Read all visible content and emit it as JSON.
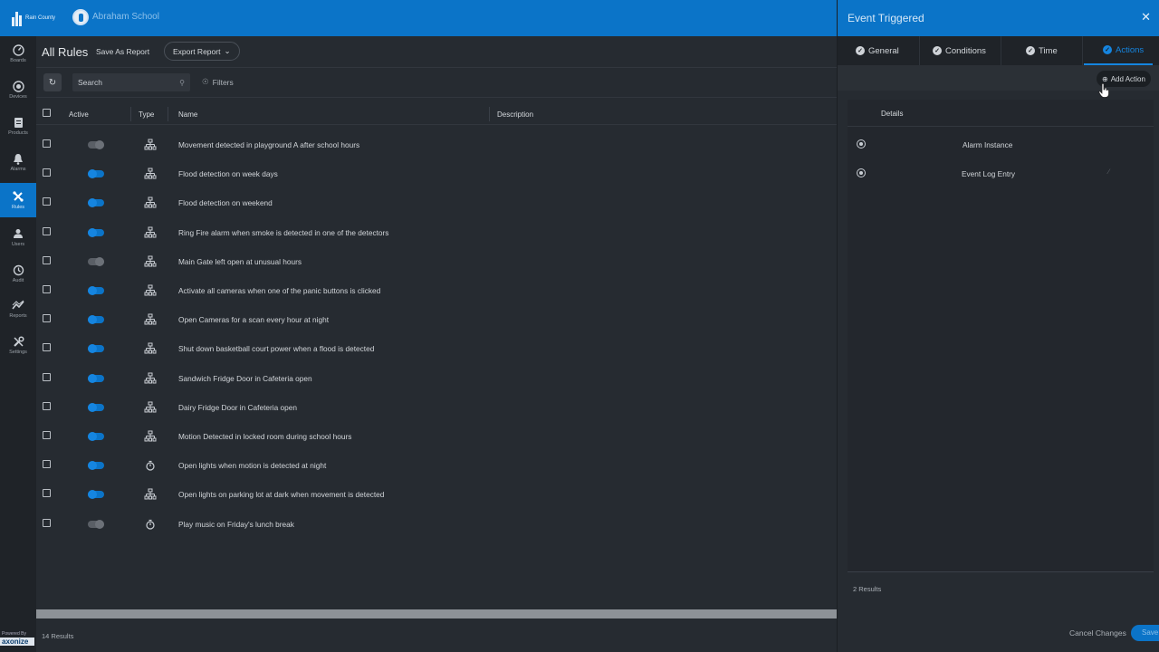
{
  "header": {
    "county_logo_text": "Rain County",
    "school_name": "Abraham School"
  },
  "sidebar": {
    "items": [
      {
        "label": "Boards",
        "icon": "boards-icon"
      },
      {
        "label": "Devices",
        "icon": "devices-icon"
      },
      {
        "label": "Products",
        "icon": "products-icon"
      },
      {
        "label": "Alarms",
        "icon": "bell-icon"
      },
      {
        "label": "Rules",
        "icon": "rules-icon",
        "active": true
      },
      {
        "label": "Users",
        "icon": "user-icon"
      },
      {
        "label": "Audit",
        "icon": "history-icon"
      },
      {
        "label": "Reports",
        "icon": "reports-icon"
      },
      {
        "label": "Settings",
        "icon": "wrench-icon"
      }
    ],
    "powered_by": "Powered By",
    "brand": "axonize"
  },
  "main": {
    "title": "All Rules",
    "save_as_report": "Save As Report",
    "export_report": "Export Report",
    "search_placeholder": "Search",
    "filters": "Filters",
    "columns": {
      "active": "Active",
      "type": "Type",
      "name": "Name",
      "description": "Description"
    },
    "rows": [
      {
        "active": false,
        "type": "tree",
        "name": "Movement detected in playground A after school hours"
      },
      {
        "active": true,
        "type": "tree",
        "name": "Flood detection on week days"
      },
      {
        "active": true,
        "type": "tree",
        "name": "Flood detection on weekend"
      },
      {
        "active": true,
        "type": "tree",
        "name": "Ring Fire alarm when smoke is detected in one of the detectors"
      },
      {
        "active": false,
        "type": "tree",
        "name": "Main Gate left open at unusual hours"
      },
      {
        "active": true,
        "type": "tree",
        "name": "Activate all cameras when one of the panic buttons is clicked"
      },
      {
        "active": true,
        "type": "tree",
        "name": "Open Cameras for a scan every hour at night"
      },
      {
        "active": true,
        "type": "tree",
        "name": "Shut down basketball court power when a flood is detected"
      },
      {
        "active": true,
        "type": "tree",
        "name": "Sandwich Fridge Door in Cafeteria open"
      },
      {
        "active": true,
        "type": "tree",
        "name": "Dairy Fridge Door in Cafeteria open"
      },
      {
        "active": true,
        "type": "tree",
        "name": "Motion Detected in locked room during school hours"
      },
      {
        "active": true,
        "type": "timer",
        "name": "Open lights when motion is detected at night"
      },
      {
        "active": true,
        "type": "tree",
        "name": "Open lights on parking lot at dark when movement is detected"
      },
      {
        "active": false,
        "type": "timer",
        "name": "Play music on Friday's lunch break"
      }
    ],
    "results": "14 Results"
  },
  "panel": {
    "title": "Event Triggered",
    "tabs": [
      "General",
      "Conditions",
      "Time",
      "Actions"
    ],
    "active_tab": "Actions",
    "add_action": "Add Action",
    "details_header": "Details",
    "details_rows": [
      "Alarm Instance",
      "Event Log Entry"
    ],
    "results": "2 Results",
    "cancel": "Cancel Changes",
    "save": "Save"
  },
  "colors": {
    "accent": "#0b74c8",
    "background": "#262b31",
    "sidebar": "#1f2328"
  }
}
